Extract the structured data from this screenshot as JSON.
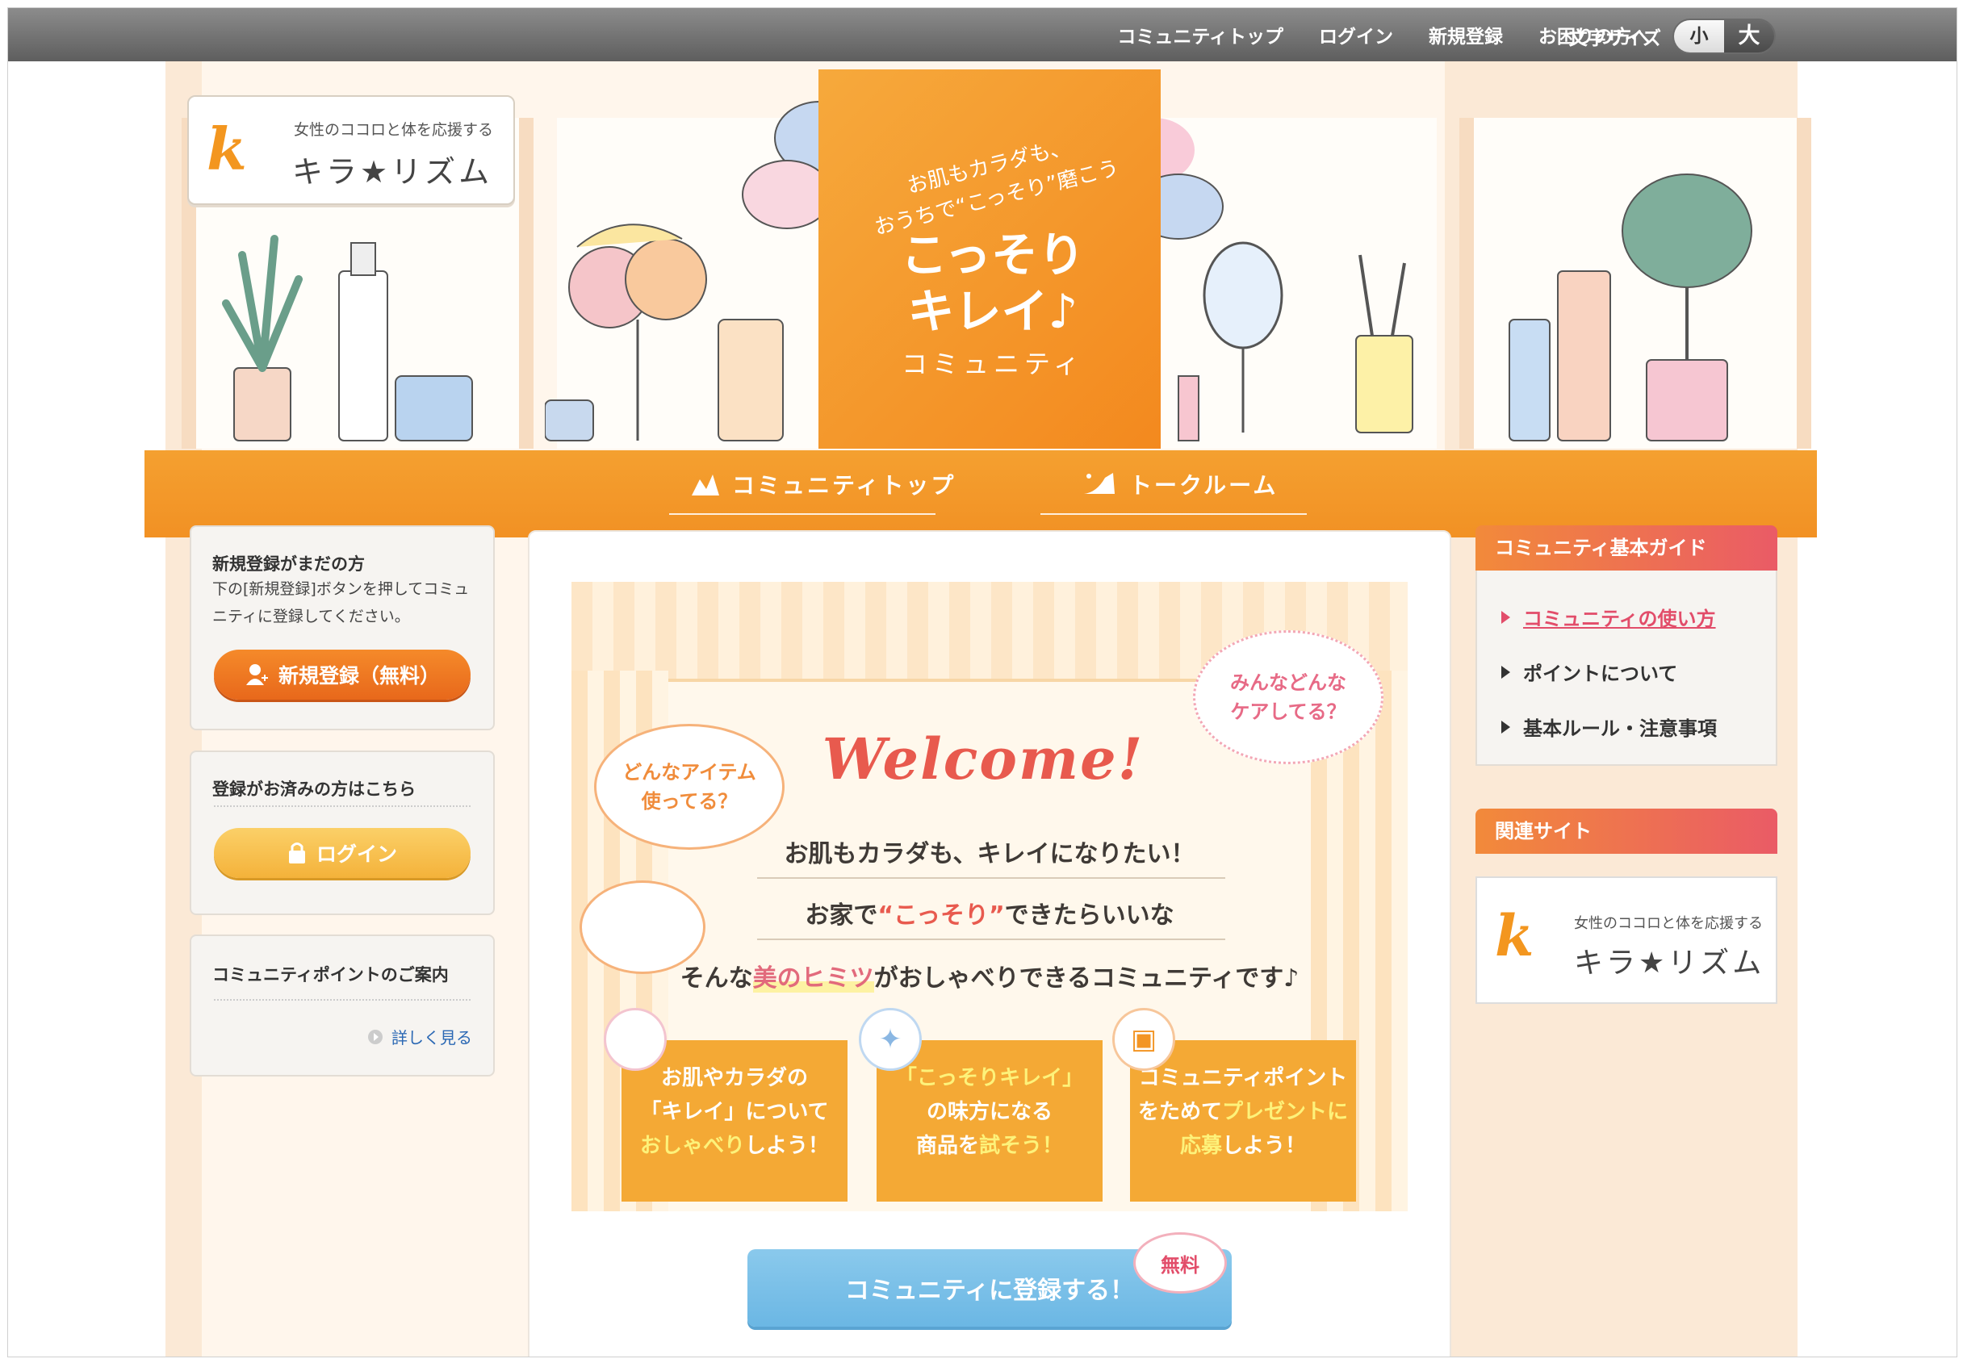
{
  "topbar": {
    "links": [
      "コミュニティトップ",
      "ログイン",
      "新規登録",
      "お困りの方へ"
    ],
    "fontsize_label": "文字サイズ",
    "fontsize_small": "小",
    "fontsize_large": "大"
  },
  "logo": {
    "tagline": "女性のココロと体を応援する",
    "name": "キラ★リズム"
  },
  "banner": {
    "subtitle_line1": "お肌もカラダも、",
    "subtitle_line2": "おうちで“こっそり”磨こう",
    "title_line1": "こっそり",
    "title_line2": "キレイ♪",
    "community": "コミュニティ"
  },
  "nav": {
    "item1": "コミュニティトップ",
    "item2": "トークルーム"
  },
  "left": {
    "register_card": {
      "title": "新規登録がまだの方",
      "desc_line1": "下の[新規登録]ボタンを押してコミュ",
      "desc_line2": "ニティに登録してください。",
      "button": "新規登録（無料）"
    },
    "login_card": {
      "title": "登録がお済みの方はこちら",
      "button": "ログイン"
    },
    "points_card": {
      "title": "コミュニティポイントのご案内",
      "link": "詳しく見る"
    }
  },
  "main": {
    "bubble_left_line1": "どんなアイテム",
    "bubble_left_line2": "使ってる？",
    "bubble_right_line1": "みんなどんな",
    "bubble_right_line2": "ケアしてる？",
    "welcome": "Welcome!",
    "line1_a": "お肌もカラダも、キレイ",
    "line1_b": "になりたい！",
    "line2_a": "お家で",
    "line2_hi": "“こっそり”",
    "line2_b": "できたらいいな",
    "line3_a": "そんな",
    "line3_hi": "美のヒミツ",
    "line3_b": "がおしゃべりできるコミュニティです♪",
    "boxes": [
      {
        "l1": "お肌やカラダの",
        "l2": "「キレイ」について",
        "l3y": "おしゃべり",
        "l3": "しよう！"
      },
      {
        "l1y": "「こっそりキレイ」",
        "l2": "の味方になる",
        "l3": "商品を",
        "l3y": "試そう！"
      },
      {
        "l1": "コミュニティポイント",
        "l2": "をためて",
        "l2y": "プレゼントに",
        "l3y": "応募",
        "l3": "しよう！"
      }
    ],
    "cta": "コミュニティに登録する！",
    "free": "無料"
  },
  "right": {
    "guide_title": "コミュニティ基本ガイド",
    "guide_links": [
      "コミュニティの使い方",
      "ポイントについて",
      "基本ルール・注意事項"
    ],
    "related_title": "関連サイト",
    "related_tagline": "女性のココロと体を応援する",
    "related_name": "キラ★リズム"
  },
  "colors": {
    "accent_orange": "#f39524",
    "accent_pink": "#e24d6a",
    "cta_blue": "#6bb7e4"
  }
}
